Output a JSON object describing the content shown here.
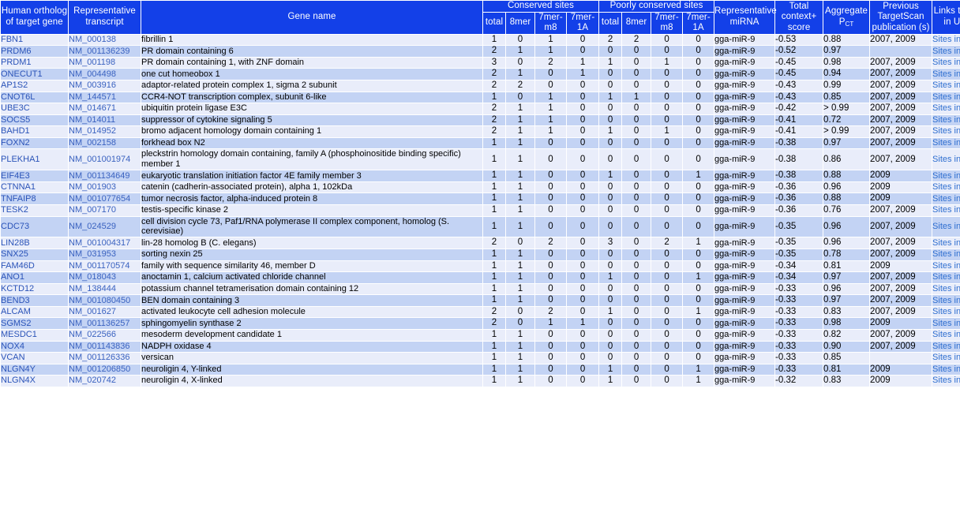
{
  "header": {
    "col_human_ortholog": "Human ortholog of target gene",
    "col_representative_transcript": "Representative transcript",
    "col_gene_name": "Gene name",
    "group_conserved": "Conserved sites",
    "group_poorly_conserved": "Poorly conserved sites",
    "sub_total": "total",
    "sub_8mer": "8mer",
    "sub_7mer_m8": "7mer-m8",
    "sub_7mer_1A": "7mer-1A",
    "col_representative_mirna": "Representative miRNA",
    "col_total_context_score": "Total context+ score",
    "col_aggregate_pct_main": "Aggregate P",
    "col_aggregate_pct_sub": "CT",
    "col_previous_publication": "Previous TargetScan publication (s)",
    "col_links_utr": "Links to sites in UTRs"
  },
  "colors": {
    "header_bg": "#1340e8",
    "header_fg": "#ffffff",
    "row_odd_bg": "#e9edfa",
    "row_even_bg": "#c3d3f4",
    "link_blue": "#2f6fd0",
    "symbol_blue": "#2a53b8"
  },
  "link_label": "Sites in UTR",
  "rows": [
    {
      "symbol": "FBN1",
      "transcript": "NM_000138",
      "gene_name": "fibrillin 1",
      "cons_total": "1",
      "cons_8mer": "0",
      "cons_7mer_m8": "1",
      "cons_7mer_1A": "0",
      "poor_total": "2",
      "poor_8mer": "2",
      "poor_7mer_m8": "0",
      "poor_7mer_1A": "0",
      "mirna": "gga-miR-9",
      "context_score": "-0.53",
      "aggregate_pct": "0.88",
      "publication": "2007, 2009",
      "link": "Sites in UTR"
    },
    {
      "symbol": "PRDM6",
      "transcript": "NM_001136239",
      "gene_name": "PR domain containing 6",
      "cons_total": "2",
      "cons_8mer": "1",
      "cons_7mer_m8": "1",
      "cons_7mer_1A": "0",
      "poor_total": "0",
      "poor_8mer": "0",
      "poor_7mer_m8": "0",
      "poor_7mer_1A": "0",
      "mirna": "gga-miR-9",
      "context_score": "-0.52",
      "aggregate_pct": "0.97",
      "publication": "",
      "link": "Sites in UTR"
    },
    {
      "symbol": "PRDM1",
      "transcript": "NM_001198",
      "gene_name": "PR domain containing 1, with ZNF domain",
      "cons_total": "3",
      "cons_8mer": "0",
      "cons_7mer_m8": "2",
      "cons_7mer_1A": "1",
      "poor_total": "1",
      "poor_8mer": "0",
      "poor_7mer_m8": "1",
      "poor_7mer_1A": "0",
      "mirna": "gga-miR-9",
      "context_score": "-0.45",
      "aggregate_pct": "0.98",
      "publication": "2007, 2009",
      "link": "Sites in UTR"
    },
    {
      "symbol": "ONECUT1",
      "transcript": "NM_004498",
      "gene_name": "one cut homeobox 1",
      "cons_total": "2",
      "cons_8mer": "1",
      "cons_7mer_m8": "0",
      "cons_7mer_1A": "1",
      "poor_total": "0",
      "poor_8mer": "0",
      "poor_7mer_m8": "0",
      "poor_7mer_1A": "0",
      "mirna": "gga-miR-9",
      "context_score": "-0.45",
      "aggregate_pct": "0.94",
      "publication": "2007, 2009",
      "link": "Sites in UTR"
    },
    {
      "symbol": "AP1S2",
      "transcript": "NM_003916",
      "gene_name": "adaptor-related protein complex 1, sigma 2 subunit",
      "cons_total": "2",
      "cons_8mer": "2",
      "cons_7mer_m8": "0",
      "cons_7mer_1A": "0",
      "poor_total": "0",
      "poor_8mer": "0",
      "poor_7mer_m8": "0",
      "poor_7mer_1A": "0",
      "mirna": "gga-miR-9",
      "context_score": "-0.43",
      "aggregate_pct": "0.99",
      "publication": "2007, 2009",
      "link": "Sites in UTR"
    },
    {
      "symbol": "CNOT6L",
      "transcript": "NM_144571",
      "gene_name": "CCR4-NOT transcription complex, subunit 6-like",
      "cons_total": "1",
      "cons_8mer": "0",
      "cons_7mer_m8": "1",
      "cons_7mer_1A": "0",
      "poor_total": "1",
      "poor_8mer": "1",
      "poor_7mer_m8": "0",
      "poor_7mer_1A": "0",
      "mirna": "gga-miR-9",
      "context_score": "-0.43",
      "aggregate_pct": "0.85",
      "publication": "2007, 2009",
      "link": "Sites in UTR"
    },
    {
      "symbol": "UBE3C",
      "transcript": "NM_014671",
      "gene_name": "ubiquitin protein ligase E3C",
      "cons_total": "2",
      "cons_8mer": "1",
      "cons_7mer_m8": "1",
      "cons_7mer_1A": "0",
      "poor_total": "0",
      "poor_8mer": "0",
      "poor_7mer_m8": "0",
      "poor_7mer_1A": "0",
      "mirna": "gga-miR-9",
      "context_score": "-0.42",
      "aggregate_pct": "> 0.99",
      "publication": "2007, 2009",
      "link": "Sites in UTR"
    },
    {
      "symbol": "SOCS5",
      "transcript": "NM_014011",
      "gene_name": "suppressor of cytokine signaling 5",
      "cons_total": "2",
      "cons_8mer": "1",
      "cons_7mer_m8": "1",
      "cons_7mer_1A": "0",
      "poor_total": "0",
      "poor_8mer": "0",
      "poor_7mer_m8": "0",
      "poor_7mer_1A": "0",
      "mirna": "gga-miR-9",
      "context_score": "-0.41",
      "aggregate_pct": "0.72",
      "publication": "2007, 2009",
      "link": "Sites in UTR"
    },
    {
      "symbol": "BAHD1",
      "transcript": "NM_014952",
      "gene_name": "bromo adjacent homology domain containing 1",
      "cons_total": "2",
      "cons_8mer": "1",
      "cons_7mer_m8": "1",
      "cons_7mer_1A": "0",
      "poor_total": "1",
      "poor_8mer": "0",
      "poor_7mer_m8": "1",
      "poor_7mer_1A": "0",
      "mirna": "gga-miR-9",
      "context_score": "-0.41",
      "aggregate_pct": "> 0.99",
      "publication": "2007, 2009",
      "link": "Sites in UTR"
    },
    {
      "symbol": "FOXN2",
      "transcript": "NM_002158",
      "gene_name": "forkhead box N2",
      "cons_total": "1",
      "cons_8mer": "1",
      "cons_7mer_m8": "0",
      "cons_7mer_1A": "0",
      "poor_total": "0",
      "poor_8mer": "0",
      "poor_7mer_m8": "0",
      "poor_7mer_1A": "0",
      "mirna": "gga-miR-9",
      "context_score": "-0.38",
      "aggregate_pct": "0.97",
      "publication": "2007, 2009",
      "link": "Sites in UTR"
    },
    {
      "symbol": "PLEKHA1",
      "transcript": "NM_001001974",
      "gene_name": "pleckstrin homology domain containing, family A (phosphoinositide binding specific) member 1",
      "cons_total": "1",
      "cons_8mer": "1",
      "cons_7mer_m8": "0",
      "cons_7mer_1A": "0",
      "poor_total": "0",
      "poor_8mer": "0",
      "poor_7mer_m8": "0",
      "poor_7mer_1A": "0",
      "mirna": "gga-miR-9",
      "context_score": "-0.38",
      "aggregate_pct": "0.86",
      "publication": "2007, 2009",
      "link": "Sites in UTR"
    },
    {
      "symbol": "EIF4E3",
      "transcript": "NM_001134649",
      "gene_name": "eukaryotic translation initiation factor 4E family member 3",
      "cons_total": "1",
      "cons_8mer": "1",
      "cons_7mer_m8": "0",
      "cons_7mer_1A": "0",
      "poor_total": "1",
      "poor_8mer": "0",
      "poor_7mer_m8": "0",
      "poor_7mer_1A": "1",
      "mirna": "gga-miR-9",
      "context_score": "-0.38",
      "aggregate_pct": "0.88",
      "publication": "2009",
      "link": "Sites in UTR"
    },
    {
      "symbol": "CTNNA1",
      "transcript": "NM_001903",
      "gene_name": "catenin (cadherin-associated protein), alpha 1, 102kDa",
      "cons_total": "1",
      "cons_8mer": "1",
      "cons_7mer_m8": "0",
      "cons_7mer_1A": "0",
      "poor_total": "0",
      "poor_8mer": "0",
      "poor_7mer_m8": "0",
      "poor_7mer_1A": "0",
      "mirna": "gga-miR-9",
      "context_score": "-0.36",
      "aggregate_pct": "0.96",
      "publication": "2009",
      "link": "Sites in UTR"
    },
    {
      "symbol": "TNFAIP8",
      "transcript": "NM_001077654",
      "gene_name": "tumor necrosis factor, alpha-induced protein 8",
      "cons_total": "1",
      "cons_8mer": "1",
      "cons_7mer_m8": "0",
      "cons_7mer_1A": "0",
      "poor_total": "0",
      "poor_8mer": "0",
      "poor_7mer_m8": "0",
      "poor_7mer_1A": "0",
      "mirna": "gga-miR-9",
      "context_score": "-0.36",
      "aggregate_pct": "0.88",
      "publication": "2009",
      "link": "Sites in UTR"
    },
    {
      "symbol": "TESK2",
      "transcript": "NM_007170",
      "gene_name": "testis-specific kinase 2",
      "cons_total": "1",
      "cons_8mer": "1",
      "cons_7mer_m8": "0",
      "cons_7mer_1A": "0",
      "poor_total": "0",
      "poor_8mer": "0",
      "poor_7mer_m8": "0",
      "poor_7mer_1A": "0",
      "mirna": "gga-miR-9",
      "context_score": "-0.36",
      "aggregate_pct": "0.76",
      "publication": "2007, 2009",
      "link": "Sites in UTR"
    },
    {
      "symbol": "CDC73",
      "transcript": "NM_024529",
      "gene_name": "cell division cycle 73, Paf1/RNA polymerase II complex component, homolog (S. cerevisiae)",
      "cons_total": "1",
      "cons_8mer": "1",
      "cons_7mer_m8": "0",
      "cons_7mer_1A": "0",
      "poor_total": "0",
      "poor_8mer": "0",
      "poor_7mer_m8": "0",
      "poor_7mer_1A": "0",
      "mirna": "gga-miR-9",
      "context_score": "-0.35",
      "aggregate_pct": "0.96",
      "publication": "2007, 2009",
      "link": "Sites in UTR"
    },
    {
      "symbol": "LIN28B",
      "transcript": "NM_001004317",
      "gene_name": "lin-28 homolog B (C. elegans)",
      "cons_total": "2",
      "cons_8mer": "0",
      "cons_7mer_m8": "2",
      "cons_7mer_1A": "0",
      "poor_total": "3",
      "poor_8mer": "0",
      "poor_7mer_m8": "2",
      "poor_7mer_1A": "1",
      "mirna": "gga-miR-9",
      "context_score": "-0.35",
      "aggregate_pct": "0.96",
      "publication": "2007, 2009",
      "link": "Sites in UTR"
    },
    {
      "symbol": "SNX25",
      "transcript": "NM_031953",
      "gene_name": "sorting nexin 25",
      "cons_total": "1",
      "cons_8mer": "1",
      "cons_7mer_m8": "0",
      "cons_7mer_1A": "0",
      "poor_total": "0",
      "poor_8mer": "0",
      "poor_7mer_m8": "0",
      "poor_7mer_1A": "0",
      "mirna": "gga-miR-9",
      "context_score": "-0.35",
      "aggregate_pct": "0.78",
      "publication": "2007, 2009",
      "link": "Sites in UTR"
    },
    {
      "symbol": "FAM46D",
      "transcript": "NM_001170574",
      "gene_name": "family with sequence similarity 46, member D",
      "cons_total": "1",
      "cons_8mer": "1",
      "cons_7mer_m8": "0",
      "cons_7mer_1A": "0",
      "poor_total": "0",
      "poor_8mer": "0",
      "poor_7mer_m8": "0",
      "poor_7mer_1A": "0",
      "mirna": "gga-miR-9",
      "context_score": "-0.34",
      "aggregate_pct": "0.81",
      "publication": "2009",
      "link": "Sites in UTR"
    },
    {
      "symbol": "ANO1",
      "transcript": "NM_018043",
      "gene_name": "anoctamin 1, calcium activated chloride channel",
      "cons_total": "1",
      "cons_8mer": "1",
      "cons_7mer_m8": "0",
      "cons_7mer_1A": "0",
      "poor_total": "1",
      "poor_8mer": "0",
      "poor_7mer_m8": "0",
      "poor_7mer_1A": "1",
      "mirna": "gga-miR-9",
      "context_score": "-0.34",
      "aggregate_pct": "0.97",
      "publication": "2007, 2009",
      "link": "Sites in UTR"
    },
    {
      "symbol": "KCTD12",
      "transcript": "NM_138444",
      "gene_name": "potassium channel tetramerisation domain containing 12",
      "cons_total": "1",
      "cons_8mer": "1",
      "cons_7mer_m8": "0",
      "cons_7mer_1A": "0",
      "poor_total": "0",
      "poor_8mer": "0",
      "poor_7mer_m8": "0",
      "poor_7mer_1A": "0",
      "mirna": "gga-miR-9",
      "context_score": "-0.33",
      "aggregate_pct": "0.96",
      "publication": "2007, 2009",
      "link": "Sites in UTR"
    },
    {
      "symbol": "BEND3",
      "transcript": "NM_001080450",
      "gene_name": "BEN domain containing 3",
      "cons_total": "1",
      "cons_8mer": "1",
      "cons_7mer_m8": "0",
      "cons_7mer_1A": "0",
      "poor_total": "0",
      "poor_8mer": "0",
      "poor_7mer_m8": "0",
      "poor_7mer_1A": "0",
      "mirna": "gga-miR-9",
      "context_score": "-0.33",
      "aggregate_pct": "0.97",
      "publication": "2007, 2009",
      "link": "Sites in UTR"
    },
    {
      "symbol": "ALCAM",
      "transcript": "NM_001627",
      "gene_name": "activated leukocyte cell adhesion molecule",
      "cons_total": "2",
      "cons_8mer": "0",
      "cons_7mer_m8": "2",
      "cons_7mer_1A": "0",
      "poor_total": "1",
      "poor_8mer": "0",
      "poor_7mer_m8": "0",
      "poor_7mer_1A": "1",
      "mirna": "gga-miR-9",
      "context_score": "-0.33",
      "aggregate_pct": "0.83",
      "publication": "2007, 2009",
      "link": "Sites in UTR"
    },
    {
      "symbol": "SGMS2",
      "transcript": "NM_001136257",
      "gene_name": "sphingomyelin synthase 2",
      "cons_total": "2",
      "cons_8mer": "0",
      "cons_7mer_m8": "1",
      "cons_7mer_1A": "1",
      "poor_total": "0",
      "poor_8mer": "0",
      "poor_7mer_m8": "0",
      "poor_7mer_1A": "0",
      "mirna": "gga-miR-9",
      "context_score": "-0.33",
      "aggregate_pct": "0.98",
      "publication": "2009",
      "link": "Sites in UTR"
    },
    {
      "symbol": "MESDC1",
      "transcript": "NM_022566",
      "gene_name": "mesoderm development candidate 1",
      "cons_total": "1",
      "cons_8mer": "1",
      "cons_7mer_m8": "0",
      "cons_7mer_1A": "0",
      "poor_total": "0",
      "poor_8mer": "0",
      "poor_7mer_m8": "0",
      "poor_7mer_1A": "0",
      "mirna": "gga-miR-9",
      "context_score": "-0.33",
      "aggregate_pct": "0.82",
      "publication": "2007, 2009",
      "link": "Sites in UTR"
    },
    {
      "symbol": "NOX4",
      "transcript": "NM_001143836",
      "gene_name": "NADPH oxidase 4",
      "cons_total": "1",
      "cons_8mer": "1",
      "cons_7mer_m8": "0",
      "cons_7mer_1A": "0",
      "poor_total": "0",
      "poor_8mer": "0",
      "poor_7mer_m8": "0",
      "poor_7mer_1A": "0",
      "mirna": "gga-miR-9",
      "context_score": "-0.33",
      "aggregate_pct": "0.90",
      "publication": "2007, 2009",
      "link": "Sites in UTR"
    },
    {
      "symbol": "VCAN",
      "transcript": "NM_001126336",
      "gene_name": "versican",
      "cons_total": "1",
      "cons_8mer": "1",
      "cons_7mer_m8": "0",
      "cons_7mer_1A": "0",
      "poor_total": "0",
      "poor_8mer": "0",
      "poor_7mer_m8": "0",
      "poor_7mer_1A": "0",
      "mirna": "gga-miR-9",
      "context_score": "-0.33",
      "aggregate_pct": "0.85",
      "publication": "",
      "link": "Sites in UTR"
    },
    {
      "symbol": "NLGN4Y",
      "transcript": "NM_001206850",
      "gene_name": "neuroligin 4, Y-linked",
      "cons_total": "1",
      "cons_8mer": "1",
      "cons_7mer_m8": "0",
      "cons_7mer_1A": "0",
      "poor_total": "1",
      "poor_8mer": "0",
      "poor_7mer_m8": "0",
      "poor_7mer_1A": "1",
      "mirna": "gga-miR-9",
      "context_score": "-0.33",
      "aggregate_pct": "0.81",
      "publication": "2009",
      "link": "Sites in UTR"
    },
    {
      "symbol": "NLGN4X",
      "transcript": "NM_020742",
      "gene_name": "neuroligin 4, X-linked",
      "cons_total": "1",
      "cons_8mer": "1",
      "cons_7mer_m8": "0",
      "cons_7mer_1A": "0",
      "poor_total": "1",
      "poor_8mer": "0",
      "poor_7mer_m8": "0",
      "poor_7mer_1A": "1",
      "mirna": "gga-miR-9",
      "context_score": "-0.32",
      "aggregate_pct": "0.83",
      "publication": "2009",
      "link": "Sites in UTR"
    }
  ]
}
